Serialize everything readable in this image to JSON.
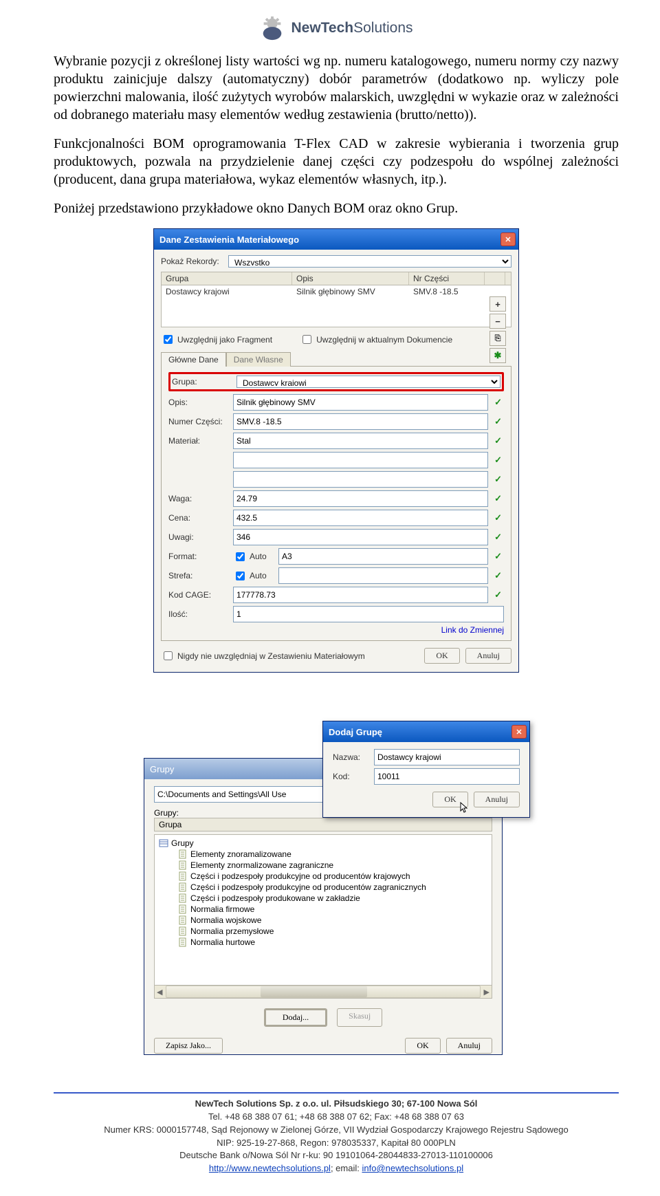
{
  "logo": {
    "name": "NewTech",
    "sub": "Solutions"
  },
  "para1": "Wybranie pozycji z określonej listy wartości wg np. numeru katalogowego, numeru normy czy nazwy produktu zainicjuje dalszy (automatyczny) dobór parametrów (dodatkowo np. wyliczy pole powierzchni malowania, ilość zużytych wyrobów malarskich, uwzględni w wykazie oraz w zależności od dobranego materiału masy elementów według zestawienia (brutto/netto)).",
  "para2": "Funkcjonalności BOM oprogramowania T-Flex CAD w zakresie wybierania i tworzenia grup produktowych, pozwala na przydzielenie danej części czy podzespołu do wspólnej zależności (producent, dana grupa materiałowa, wykaz elementów własnych, itp.).",
  "para3": "Poniżej przedstawiono przykładowe okno Danych BOM oraz okno Grup.",
  "dlg1": {
    "title": "Dane Zestawienia Materiałowego",
    "pokaz_label": "Pokaż Rekordy:",
    "pokaz_value": "Wszystko",
    "hdr_grupa": "Grupa",
    "hdr_opis": "Opis",
    "hdr_nr": "Nr Części",
    "row_grupa": "Dostawcy krajowi",
    "row_opis": "Silnik głębinowy SMV",
    "row_nr": "SMV.8 -18.5",
    "chk_fragment": "Uwzględnij jako Fragment",
    "chk_aktualnym": "Uwzględnij w aktualnym Dokumencie",
    "tab_main": "Główne Dane",
    "tab_own": "Dane Własne",
    "grupa_lbl": "Grupa:",
    "grupa_val": "Dostawcy krajowi",
    "opis_lbl": "Opis:",
    "opis_val": "Silnik głębinowy SMV",
    "numer_lbl": "Numer Części:",
    "numer_val": "SMV.8 -18.5",
    "material_lbl": "Materiał:",
    "material_val": "Stal",
    "waga_lbl": "Waga:",
    "waga_val": "24.79",
    "cena_lbl": "Cena:",
    "cena_val": "432.5",
    "uwagi_lbl": "Uwagi:",
    "uwagi_val": "346",
    "format_lbl": "Format:",
    "format_auto": "Auto",
    "format_val": "A3",
    "strefa_lbl": "Strefa:",
    "strefa_auto": "Auto",
    "kod_lbl": "Kod CAGE:",
    "kod_val": "177778.73",
    "ilosc_lbl": "Ilość:",
    "ilosc_val": "1",
    "link": "Link do Zmiennej",
    "nigdy": "Nigdy nie uwzględniaj w Zestawieniu Materiałowym",
    "ok": "OK",
    "anuluj": "Anuluj"
  },
  "dlg2": {
    "title": "Grupy",
    "path": "C:\\Documents and Settings\\All Use",
    "grupy_lbl": "Grupy:",
    "tree_hdr": "Grupa",
    "root": "Grupy",
    "items": [
      "Elementy znoramalizowane",
      "Elementy znormalizowane zagraniczne",
      "Części i podzespoły produkcyjne od producentów krajowych",
      "Części i podzespoły produkcyjne od producentów zagranicznych",
      "Części i podzespoły produkowane w zakładzie",
      "Normalia firmowe",
      "Normalia wojskowe",
      "Normalia przemysłowe",
      "Normalia hurtowe"
    ],
    "dodaj": "Dodaj...",
    "skasuj": "Skasuj",
    "zapisz": "Zapisz Jako...",
    "ok": "OK",
    "anuluj": "Anuluj"
  },
  "dlg3": {
    "title": "Dodaj Grupę",
    "nazwa_lbl": "Nazwa:",
    "nazwa_val": "Dostawcy krajowi",
    "kod_lbl": "Kod:",
    "kod_val": "10011",
    "ok": "OK",
    "anuluj": "Anuluj"
  },
  "footer": {
    "company": "NewTech Solutions Sp. z o.o. ul. Piłsudskiego 30; 67-100 Nowa Sól",
    "tel": "Tel. +48 68 388 07 61; +48 68 388 07 62; Fax: +48 68 388 07 63",
    "krs": "Numer KRS: 0000157748, Sąd Rejonowy w Zielonej Górze, VII Wydział Gospodarczy Krajowego Rejestru Sądowego",
    "nip": "NIP: 925-19-27-868, Regon: 978035337, Kapitał 80 000PLN",
    "bank": "Deutsche Bank o/Nowa Sól Nr r-ku: 90 19101064-28044833-27013-110100006",
    "url": "http://www.newtechsolutions.pl",
    "email_lbl": "; email: ",
    "email": "info@newtechsolutions.pl"
  }
}
